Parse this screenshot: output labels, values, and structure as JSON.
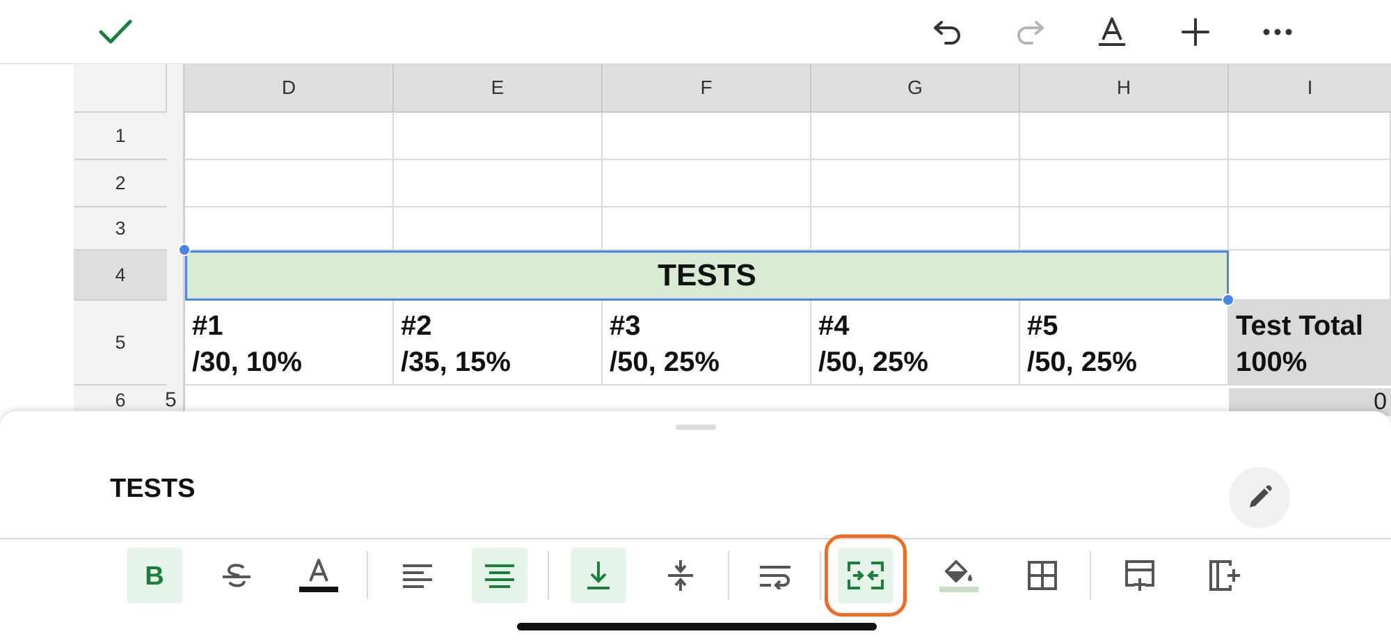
{
  "toolbar": {
    "confirm_icon": "check-icon",
    "undo_icon": "undo-icon",
    "redo_icon": "redo-icon",
    "text_format_icon": "text-format-icon",
    "insert_icon": "plus-icon",
    "more_icon": "more-horizontal-icon"
  },
  "grid": {
    "columns": [
      "D",
      "E",
      "F",
      "G",
      "H",
      "I"
    ],
    "rows": [
      "1",
      "2",
      "3",
      "4",
      "5",
      "6"
    ],
    "merged_cell": "TESTS",
    "headers": [
      {
        "line1": "#1",
        "line2": "/30, 10%"
      },
      {
        "line1": "#2",
        "line2": "/35, 15%"
      },
      {
        "line1": "#3",
        "line2": "/50, 25%"
      },
      {
        "line1": "#4",
        "line2": "/50, 25%"
      },
      {
        "line1": "#5",
        "line2": "/50, 25%"
      },
      {
        "line1": "Test Total",
        "line2": "100%"
      }
    ],
    "row6_total": "0",
    "row6_partial": "5"
  },
  "sheet": {
    "formula_value": "TESTS",
    "edit_icon": "pencil-icon"
  },
  "format_bar": [
    {
      "name": "bold",
      "icon": "bold-icon",
      "active": true
    },
    {
      "name": "strikethrough",
      "icon": "strikethrough-icon",
      "active": false
    },
    {
      "name": "text-color",
      "icon": "text-color-icon",
      "active": false
    },
    {
      "name": "align-left",
      "icon": "align-left-icon",
      "active": false
    },
    {
      "name": "align-center",
      "icon": "align-center-icon",
      "active": true
    },
    {
      "name": "valign-bottom",
      "icon": "valign-bottom-icon",
      "active": true
    },
    {
      "name": "valign-middle",
      "icon": "valign-middle-icon",
      "active": false
    },
    {
      "name": "wrap",
      "icon": "text-wrap-icon",
      "active": false
    },
    {
      "name": "merge",
      "icon": "merge-cells-icon",
      "active": true,
      "highlighted": true
    },
    {
      "name": "fill-color",
      "icon": "fill-color-icon",
      "active": false
    },
    {
      "name": "borders",
      "icon": "borders-icon",
      "active": false
    },
    {
      "name": "insert-row",
      "icon": "insert-row-icon",
      "active": false
    },
    {
      "name": "insert-column",
      "icon": "insert-column-icon",
      "active": false
    }
  ],
  "colors": {
    "accent_green": "#188038",
    "selection_blue": "#4a86e8",
    "merged_fill": "#d9ead3",
    "highlight_orange": "#f26b21"
  }
}
